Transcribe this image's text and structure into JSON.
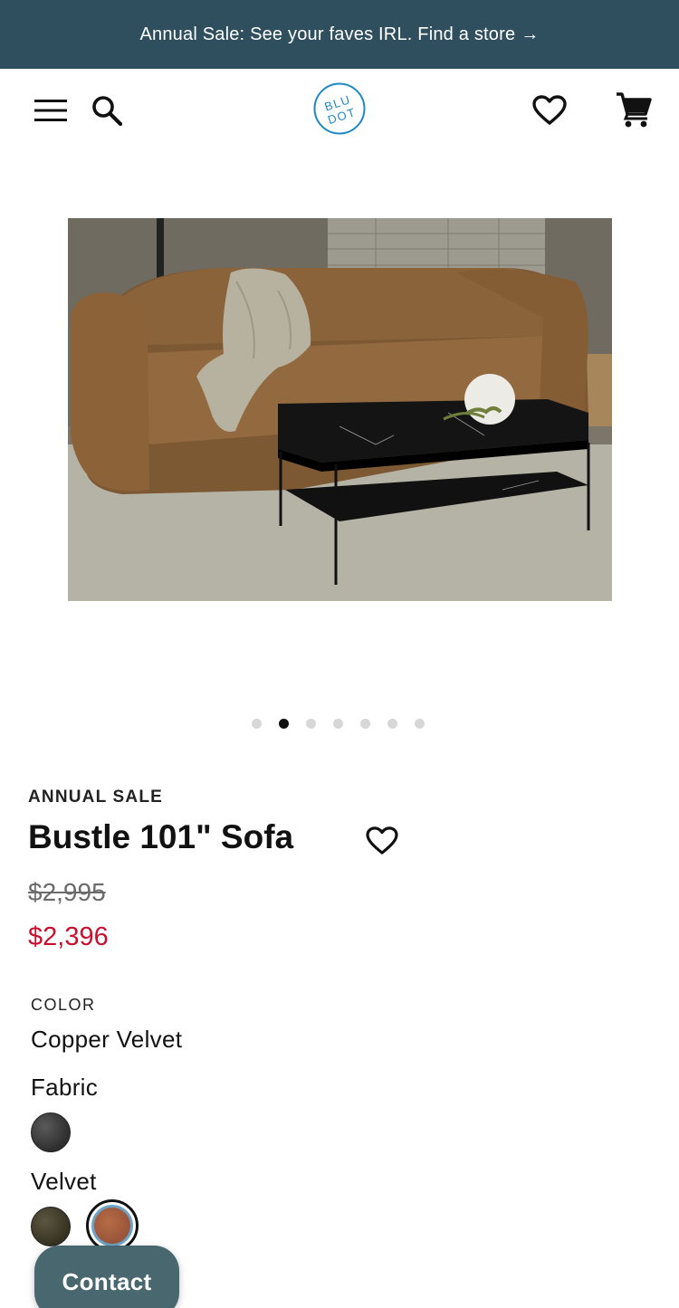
{
  "promo": {
    "text": "Annual Sale: See your faves IRL. Find a store",
    "arrow": "→"
  },
  "header": {
    "logo_text": "BLU DOT",
    "icons": [
      "menu-icon",
      "search-icon",
      "heart-icon",
      "cart-icon"
    ]
  },
  "gallery": {
    "slide_count": 7,
    "active_index": 1
  },
  "product": {
    "badge": "ANNUAL SALE",
    "title": "Bustle 101\" Sofa",
    "price_original": "$2,995",
    "price_sale": "$2,396"
  },
  "options": {
    "color_label": "COLOR",
    "color_value": "Copper Velvet",
    "groups": [
      {
        "label": "Fabric",
        "swatches": [
          {
            "name": "charcoal",
            "color": "#3f3f3f"
          }
        ]
      },
      {
        "label": "Velvet",
        "swatches": [
          {
            "name": "olive",
            "color": "#47432e"
          },
          {
            "name": "copper",
            "color": "#a65e3e",
            "selected": true
          }
        ]
      }
    ]
  },
  "contact": {
    "label": "Contact"
  },
  "colors": {
    "promo_bg": "#2f4f5e",
    "sale_red": "#c8102e",
    "logo_blue": "#1e88c7",
    "contact_bg": "#48676f"
  }
}
